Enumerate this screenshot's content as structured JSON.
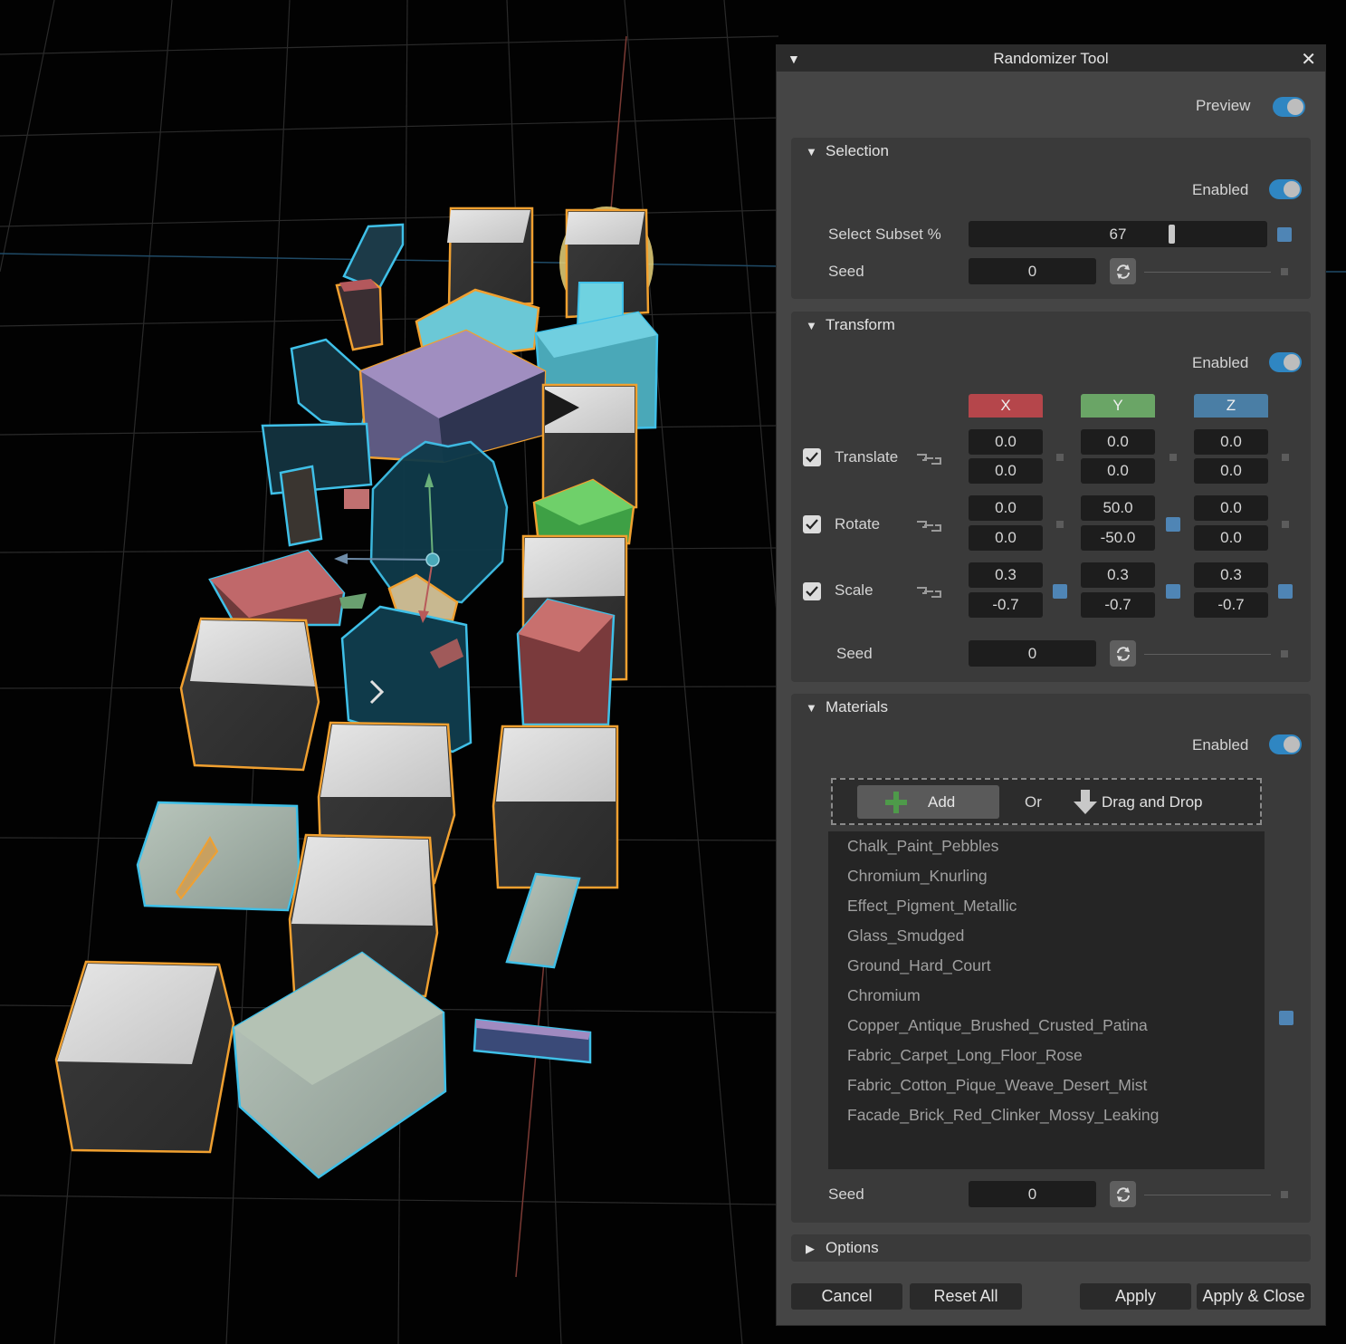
{
  "window": {
    "title": "Randomizer Tool"
  },
  "preview": {
    "label": "Preview",
    "on": true
  },
  "selection": {
    "title": "Selection",
    "enabled_label": "Enabled",
    "subset_label": "Select Subset %",
    "subset_value": "67",
    "subset_fraction": 0.67,
    "seed_label": "Seed",
    "seed_value": "0"
  },
  "transform": {
    "title": "Transform",
    "enabled_label": "Enabled",
    "axes": [
      "X",
      "Y",
      "Z"
    ],
    "axis_colors": [
      "#b5464b",
      "#6aa566",
      "#4a7ea5"
    ],
    "rows": [
      {
        "label": "Translate",
        "checked": true,
        "x": [
          "0.0",
          "0.0"
        ],
        "y": [
          "0.0",
          "0.0"
        ],
        "z": [
          "0.0",
          "0.0"
        ]
      },
      {
        "label": "Rotate",
        "checked": true,
        "x": [
          "0.0",
          "0.0"
        ],
        "y": [
          "50.0",
          "-50.0"
        ],
        "z": [
          "0.0",
          "0.0"
        ]
      },
      {
        "label": "Scale",
        "checked": true,
        "x": [
          "0.3",
          "-0.7"
        ],
        "y": [
          "0.3",
          "-0.7"
        ],
        "z": [
          "0.3",
          "-0.7"
        ]
      }
    ],
    "seed_label": "Seed",
    "seed_value": "0"
  },
  "materials": {
    "title": "Materials",
    "enabled_label": "Enabled",
    "add_label": "Add",
    "or_label": "Or",
    "drop_label": "Drag and Drop",
    "items": [
      "Chalk_Paint_Pebbles",
      "Chromium_Knurling",
      "Effect_Pigment_Metallic",
      "Glass_Smudged",
      "Ground_Hard_Court",
      "Chromium",
      "Copper_Antique_Brushed_Crusted_Patina",
      "Fabric_Carpet_Long_Floor_Rose",
      "Fabric_Cotton_Pique_Weave_Desert_Mist",
      "Facade_Brick_Red_Clinker_Mossy_Leaking"
    ],
    "seed_label": "Seed",
    "seed_value": "0"
  },
  "options": {
    "title": "Options"
  },
  "buttons": {
    "cancel": "Cancel",
    "reset": "Reset All",
    "apply": "Apply",
    "apply_close": "Apply & Close"
  },
  "colors": {
    "accent": "#2f86c2",
    "selection_orange": "#f0a030",
    "selection_cyan": "#3fc0e8"
  }
}
